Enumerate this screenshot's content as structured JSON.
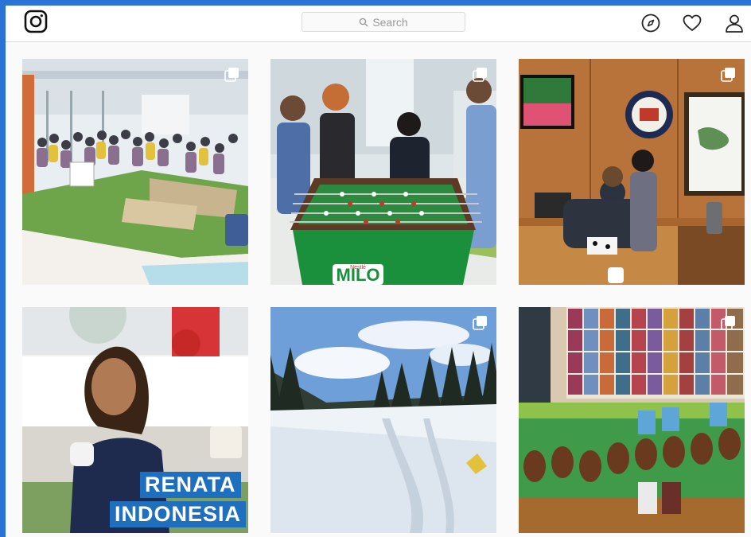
{
  "header": {
    "logo_icon": "instagram-camera-icon",
    "search": {
      "placeholder": "Search",
      "icon": "search-icon"
    },
    "nav": [
      {
        "name": "explore",
        "icon": "compass-icon"
      },
      {
        "name": "activity",
        "icon": "heart-icon"
      },
      {
        "name": "profile",
        "icon": "user-icon"
      }
    ]
  },
  "posts": [
    {
      "id": "office-event",
      "multi": true
    },
    {
      "id": "foosball-milo",
      "multi": true,
      "overlay_text": "MILO",
      "brand_text": "Nestlé"
    },
    {
      "id": "office-desk",
      "multi": true
    },
    {
      "id": "portrait",
      "multi": false,
      "caption": [
        "RENATA",
        "INDONESIA"
      ]
    },
    {
      "id": "snow-landscape",
      "multi": true
    },
    {
      "id": "chocolate-shelves",
      "multi": true
    }
  ],
  "colors": {
    "page_frame": "#2a72d6",
    "background": "#fafafa",
    "border": "#dbdbdb",
    "caption_bg": "#1f6fbf",
    "milo_green": "#1a8f3c"
  }
}
